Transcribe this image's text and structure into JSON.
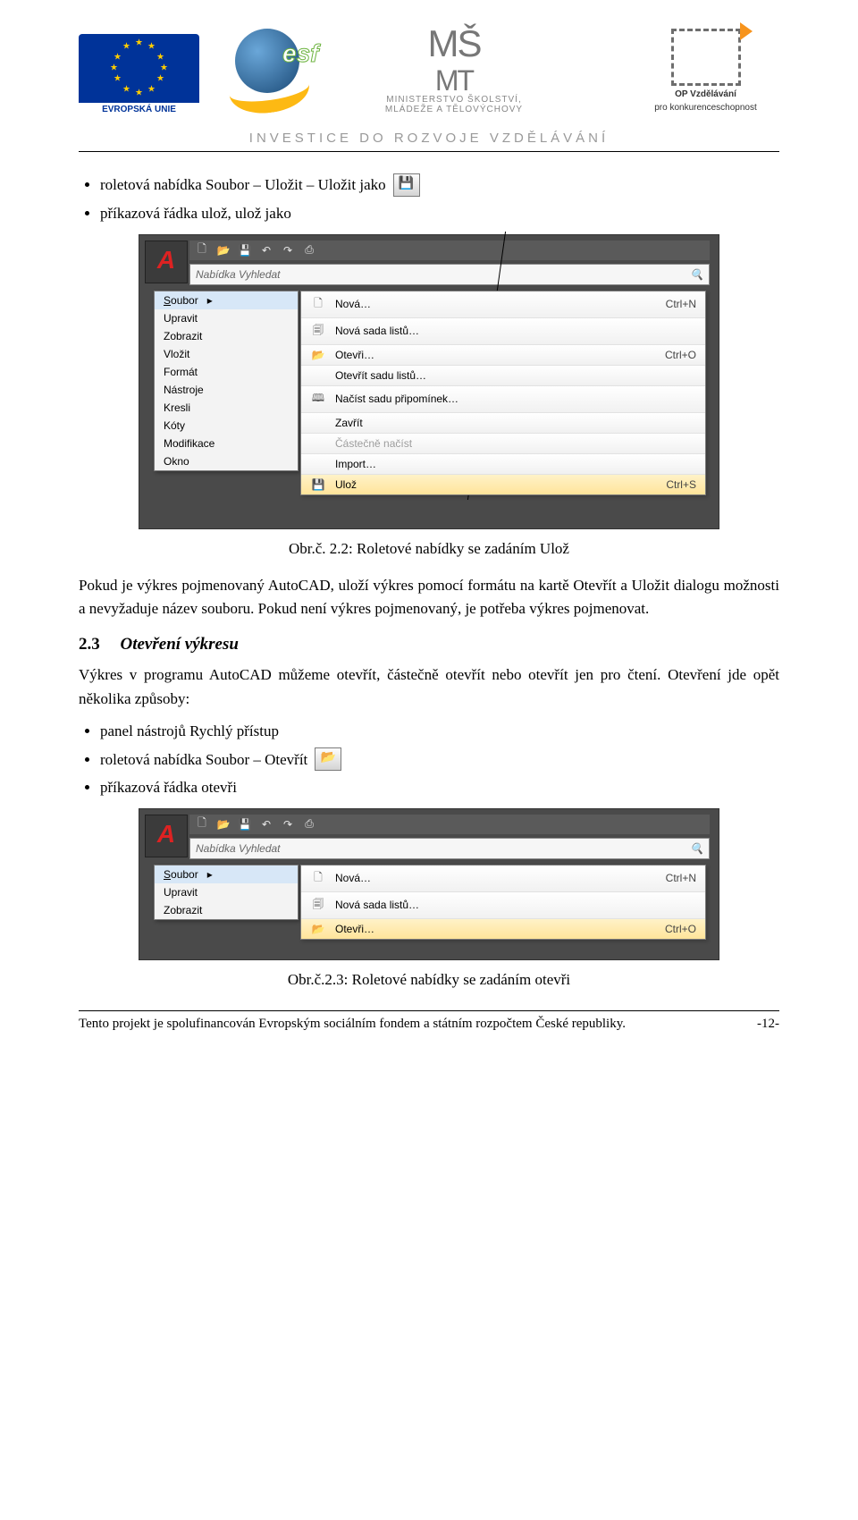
{
  "header": {
    "eu_label": "EVROPSKÁ UNIE",
    "msmt_icon": "MŠMT",
    "msmt_line1": "MINISTERSTVO ŠKOLSTVÍ,",
    "msmt_line2": "MLÁDEŽE A TĚLOVÝCHOVY",
    "op_line1": "OP Vzdělávání",
    "op_line2": "pro konkurenceschopnost",
    "tagline": "INVESTICE DO ROZVOJE VZDĚLÁVÁNÍ"
  },
  "bullets_top": [
    "roletová nabídka Soubor – Uložit – Uložit jako",
    "příkazová řádka ulož, ulož jako"
  ],
  "icons": {
    "save": "💾",
    "open": "📂",
    "search": "🔍"
  },
  "screenshot1": {
    "search_placeholder": "Nabídka Vyhledat",
    "menu_left": [
      "Soubor",
      "Upravit",
      "Zobrazit",
      "Vložit",
      "Formát",
      "Nástroje",
      "Kresli",
      "Kóty",
      "Modifikace",
      "Okno"
    ],
    "submenu": [
      {
        "icon": "🗋",
        "label": "Nová…",
        "short": "Ctrl+N"
      },
      {
        "icon": "🗐",
        "label": "Nová sada listů…",
        "short": ""
      },
      {
        "icon": "📂",
        "label": "Otevři…",
        "short": "Ctrl+O"
      },
      {
        "icon": "",
        "label": "Otevřít sadu listů…",
        "short": ""
      },
      {
        "icon": "🕮",
        "label": "Načíst sadu připomínek…",
        "short": ""
      },
      {
        "icon": "",
        "label": "Zavřít",
        "short": ""
      },
      {
        "icon": "",
        "label": "Částečně načíst",
        "short": "",
        "disabled": true
      },
      {
        "icon": "",
        "label": "Import…",
        "short": ""
      },
      {
        "icon": "💾",
        "label": "Ulož",
        "short": "Ctrl+S",
        "highlight": true
      }
    ]
  },
  "caption1": "Obr.č. 2.2: Roletové nabídky se zadáním Ulož",
  "para1": "Pokud je výkres pojmenovaný AutoCAD, uloží výkres pomocí formátu na kartě Otevřít a Uložit dialogu možnosti a nevyžaduje název souboru. Pokud není výkres pojmenovaný, je potřeba výkres pojmenovat.",
  "section23": {
    "num": "2.3",
    "title": "Otevření výkresu"
  },
  "para2": "Výkres v programu AutoCAD můžeme otevřít, částečně otevřít nebo otevřít jen pro čtení. Otevření jde opět několika způsoby:",
  "bullets_mid": [
    "panel nástrojů Rychlý přístup",
    "roletová nabídka Soubor – Otevřít",
    "příkazová řádka otevři"
  ],
  "screenshot2": {
    "search_placeholder": "Nabídka Vyhledat",
    "menu_left": [
      "Soubor",
      "Upravit",
      "Zobrazit"
    ],
    "submenu": [
      {
        "icon": "🗋",
        "label": "Nová…",
        "short": "Ctrl+N"
      },
      {
        "icon": "🗐",
        "label": "Nová sada listů…",
        "short": ""
      },
      {
        "icon": "📂",
        "label": "Otevři…",
        "short": "Ctrl+O",
        "highlight": true
      }
    ]
  },
  "caption2": "Obr.č.2.3: Roletové nabídky se zadáním otevři",
  "footer": {
    "text": "Tento projekt je spolufinancován Evropským sociálním fondem a státním rozpočtem České republiky.",
    "page": "-12-"
  }
}
